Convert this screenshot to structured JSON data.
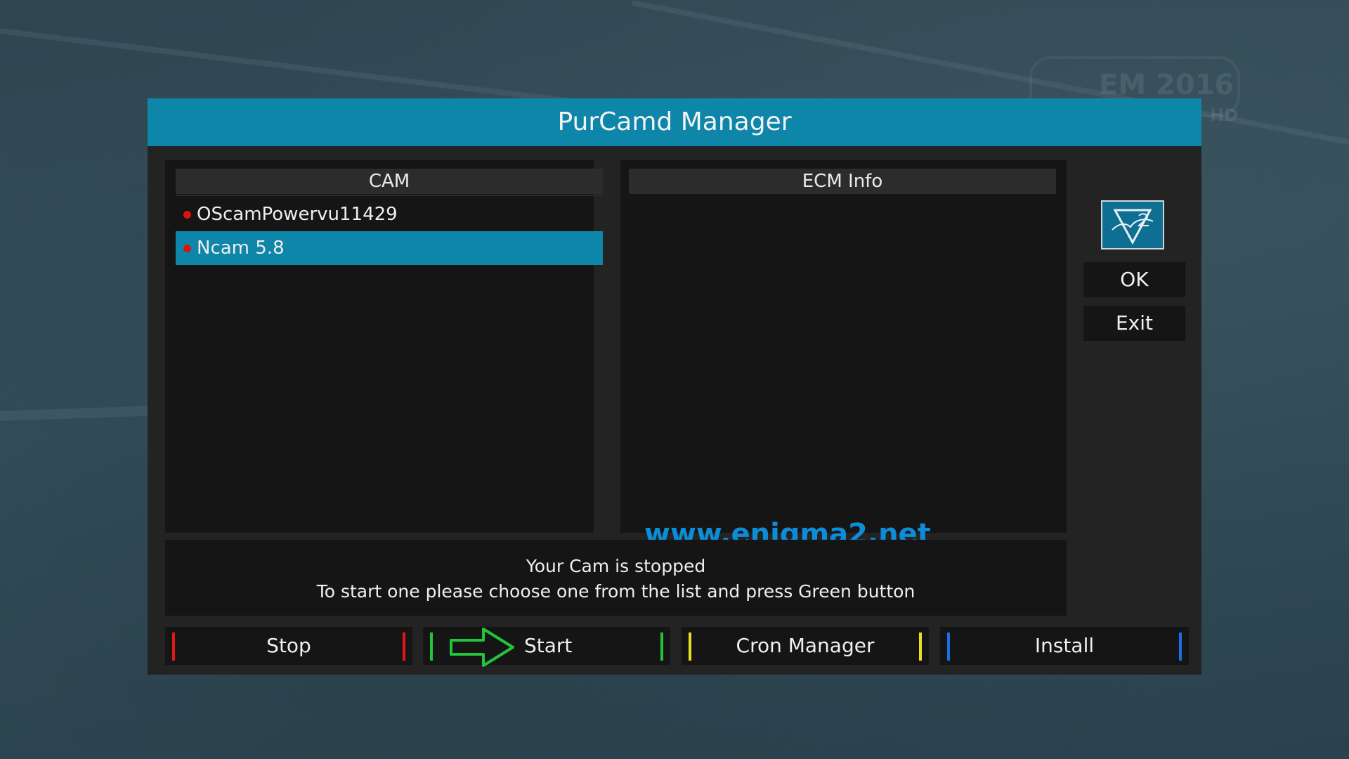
{
  "window": {
    "title": "PurCamd Manager"
  },
  "cam_panel": {
    "header": "CAM",
    "items": [
      {
        "label": "OScamPowervu11429",
        "status_color": "#e01010",
        "selected": false
      },
      {
        "label": "Ncam 5.8",
        "status_color": "#e01010",
        "selected": true
      }
    ]
  },
  "ecm_panel": {
    "header": "ECM Info"
  },
  "watermark": "www.enigma2.net",
  "side": {
    "logo_icon": "pure2-logo-icon",
    "ok_label": "OK",
    "exit_label": "Exit"
  },
  "status": {
    "line1": "Your Cam is stopped",
    "line2": "To start one please choose one from the list and press Green button"
  },
  "color_buttons": {
    "stop": {
      "label": "Stop",
      "color": "#e01818"
    },
    "start": {
      "label": "Start",
      "color": "#21c43a"
    },
    "cron": {
      "label": "Cron Manager",
      "color": "#e8e020"
    },
    "install": {
      "label": "Install",
      "color": "#1a6fe8"
    }
  },
  "colors": {
    "accent": "#0e86a9",
    "panel": "#151515",
    "dialog": "#232323"
  },
  "background": {
    "channel_logo": "EM 2016",
    "channel_tag": "HD"
  }
}
